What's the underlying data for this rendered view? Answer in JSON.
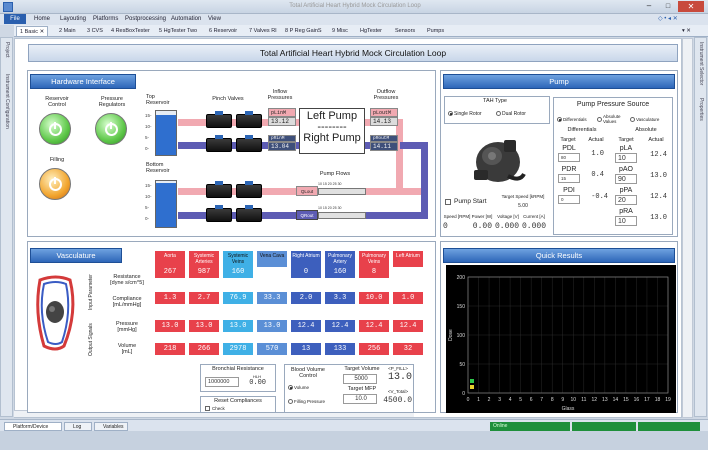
{
  "window": {
    "title": "Total Artificial Heart Hybrid Mock Circulation Loop"
  },
  "menu": {
    "file": "File",
    "items": [
      "Home",
      "Layouting",
      "Platforms",
      "Postprocessing",
      "Automation",
      "View"
    ]
  },
  "tabs": [
    "1 Basic",
    "2 Main",
    "3 CVS",
    "4 ResBoxTester",
    "5 HgTester Two",
    "6 Reservoir",
    "7 Valves RI",
    "8 P Reg GainS",
    "9 Misc",
    "HgTester",
    "Sensors",
    "Pumps"
  ],
  "side_left": [
    "Project",
    "Instrument Configuration"
  ],
  "side_right": [
    "Instrument Selector",
    "Properties"
  ],
  "banner": "Total Artificial Heart Hybrid Mock Circulation Loop",
  "hardware": {
    "title": "Hardware Interface",
    "reservoir_control": "Reservoir\nControl",
    "pressure_regulators": "Pressure\nRegulators",
    "filling": "Filling",
    "top_reservoir": "Top\nReservoir",
    "bottom_reservoir": "Bottom\nReservoir",
    "pinch_valves": "Pinch Valves",
    "inflow_pressures": "Inflow\nPressures",
    "outflow_pressures": "Outflow\nPressures",
    "pump_flows": "Pump Flows",
    "left_pump": "Left Pump",
    "dashes": "--------",
    "right_pump": "Right Pump",
    "pl_in": {
      "label": "pLinM",
      "value": "13.12"
    },
    "pr_in": {
      "label": "pRinM",
      "value": "13.04"
    },
    "pl_out": {
      "label": "pLoutM",
      "value": "14.13"
    },
    "pr_out": {
      "label": "pRoutM",
      "value": "14.11"
    },
    "ql": "QLout",
    "qr": "QRout",
    "flow_ticks": [
      "10",
      "15",
      "20",
      "25",
      "30"
    ]
  },
  "pump": {
    "title": "Pump",
    "tah_type": "TAH Type",
    "single": "Single Rotor",
    "dual": "Dual Rotor",
    "pump_start": "Pump Start",
    "target_speed": "Target Speed [kRPM]",
    "target_speed_value": "5.00",
    "speed_hdr": "Speed [RPM]",
    "power_hdr": "Power [W]",
    "voltage_hdr": "Voltage [V]",
    "current_hdr": "Current [A]",
    "speed": "0",
    "power": "0.00",
    "voltage": "0.000",
    "current": "0.000",
    "pps_title": "Pump Pressure Source",
    "opt_diff": "Differentials",
    "opt_abs": "Absolute Values",
    "opt_vasc": "Vasculature",
    "diff_hdr": "Differentials",
    "abs_hdr": "Absolute",
    "target": "Target",
    "actual": "Actual",
    "pdl": {
      "label": "PDL",
      "target": "80",
      "actual": "1.0"
    },
    "pdr": {
      "label": "PDR",
      "target": "15",
      "actual": "0.4"
    },
    "pdi": {
      "label": "PDI",
      "target": "0",
      "actual": "-0.4"
    },
    "pla": {
      "label": "pLA",
      "target": "10",
      "actual": "12.4"
    },
    "pao": {
      "label": "pAO",
      "target": "90",
      "actual": "13.0"
    },
    "ppa": {
      "label": "pPA",
      "target": "20",
      "actual": "12.4"
    },
    "pra": {
      "label": "pRA",
      "target": "10",
      "actual": "13.0"
    }
  },
  "vasculature": {
    "title": "Vasculature",
    "columns": [
      "Aorta",
      "Systemic Arteries",
      "Systemic Veins",
      "Vena Cava",
      "Right Atrium",
      "Pulmonary Artery",
      "Pulmonary Veins",
      "Left Atrium"
    ],
    "col_colors": [
      "#e8414b",
      "#e8414b",
      "#3fb0e6",
      "#5b8fd6",
      "#3d5fbd",
      "#3d5fbd",
      "#e8414b",
      "#e8414b"
    ],
    "input_group": "Input Parameter",
    "output_group": "Output Signals",
    "resistance_label": "Resistance\n[dyne s/cm^5]",
    "compliance_label": "Compliance\n[mL/mmHg]",
    "pressure_label": "Pressure\n[mmHg]",
    "volume_label": "Volume\n[mL]",
    "resistance": [
      "267",
      "987",
      "160",
      "",
      "0",
      "160",
      "8",
      ""
    ],
    "compliance": [
      "1.3",
      "2.7",
      "76.9",
      "33.3",
      "2.0",
      "3.3",
      "10.0",
      "1.0"
    ],
    "pressure": [
      "13.0",
      "13.0",
      "13.0",
      "13.0",
      "12.4",
      "12.4",
      "12.4",
      "12.4"
    ],
    "volume": [
      "218",
      "266",
      "2978",
      "570",
      "13",
      "133",
      "256",
      "32"
    ],
    "bronchial_title": "Bronchial Resistance",
    "bronchial_value": "1000000",
    "hl_label": "HLH",
    "hl_value": "0.00",
    "reset_title": "Reset Compliances",
    "reset_check": "Check",
    "bvc_title": "Blood Volume\nControl",
    "bvc_volume": "Volume",
    "bvc_filling": "Filling Pressure",
    "target_volume_label": "Target Volume",
    "target_volume": "5000",
    "target_mfp_label": "Target MFP",
    "target_mfp": "10.0",
    "p_fill_label": "<P_FILL>",
    "p_fill": "13.0",
    "v_total_label": "<V_Total>",
    "v_total": "4500.0"
  },
  "results": {
    "title": "Quick Results",
    "y_ticks": [
      "200",
      "150",
      "100",
      "50",
      "0"
    ],
    "x_ticks": [
      "0",
      "1",
      "2",
      "3",
      "4",
      "5",
      "6",
      "7",
      "8",
      "9",
      "10",
      "11",
      "12",
      "13",
      "14",
      "15",
      "16",
      "17",
      "18",
      "19"
    ],
    "xlabel": "Glass",
    "ylabel": "Dose"
  },
  "status": {
    "online": "Online"
  },
  "bottom_tabs": [
    "Platform/Device",
    "Log",
    "Variables"
  ]
}
